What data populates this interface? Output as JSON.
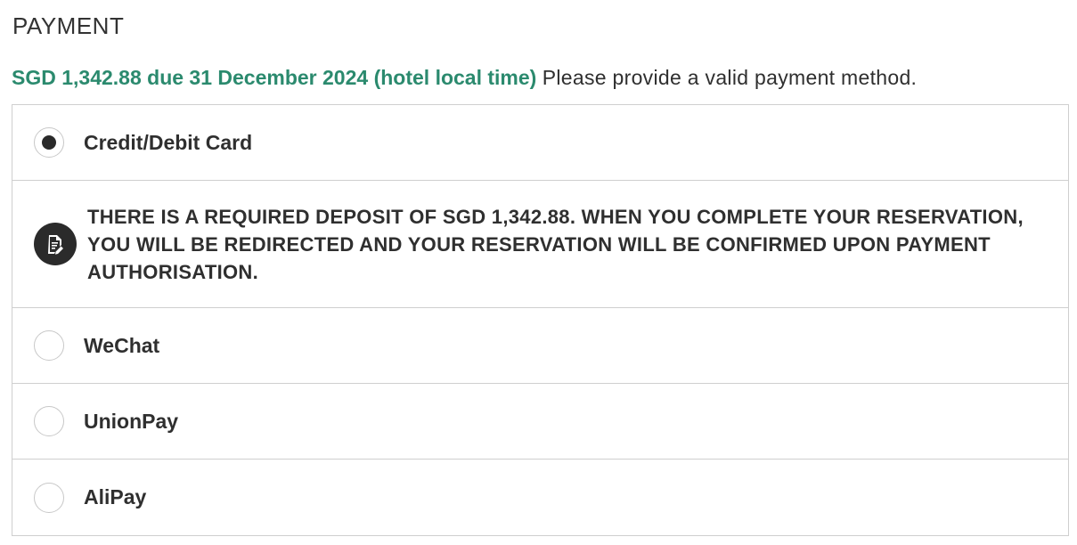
{
  "section": {
    "title": "PAYMENT"
  },
  "due": {
    "amount_text": "SGD 1,342.88 due 31 December 2024 (hotel local time)",
    "note": "Please provide a valid payment method."
  },
  "methods": [
    {
      "label": "Credit/Debit Card",
      "selected": true
    },
    {
      "label": "WeChat",
      "selected": false
    },
    {
      "label": "UnionPay",
      "selected": false
    },
    {
      "label": "AliPay",
      "selected": false
    }
  ],
  "deposit_notice": {
    "icon": "document-edit-icon",
    "text": "THERE IS A REQUIRED DEPOSIT OF SGD 1,342.88. WHEN YOU COMPLETE YOUR RESERVATION, YOU WILL BE REDIRECTED AND YOUR RESERVATION WILL BE CONFIRMED UPON PAYMENT AUTHORISATION."
  },
  "colors": {
    "accent": "#2b8a6e",
    "text": "#2f2f2f",
    "border": "#cfcfcf",
    "radio_selected": "#2a2a2a",
    "icon_bg": "#2b2b2b"
  }
}
